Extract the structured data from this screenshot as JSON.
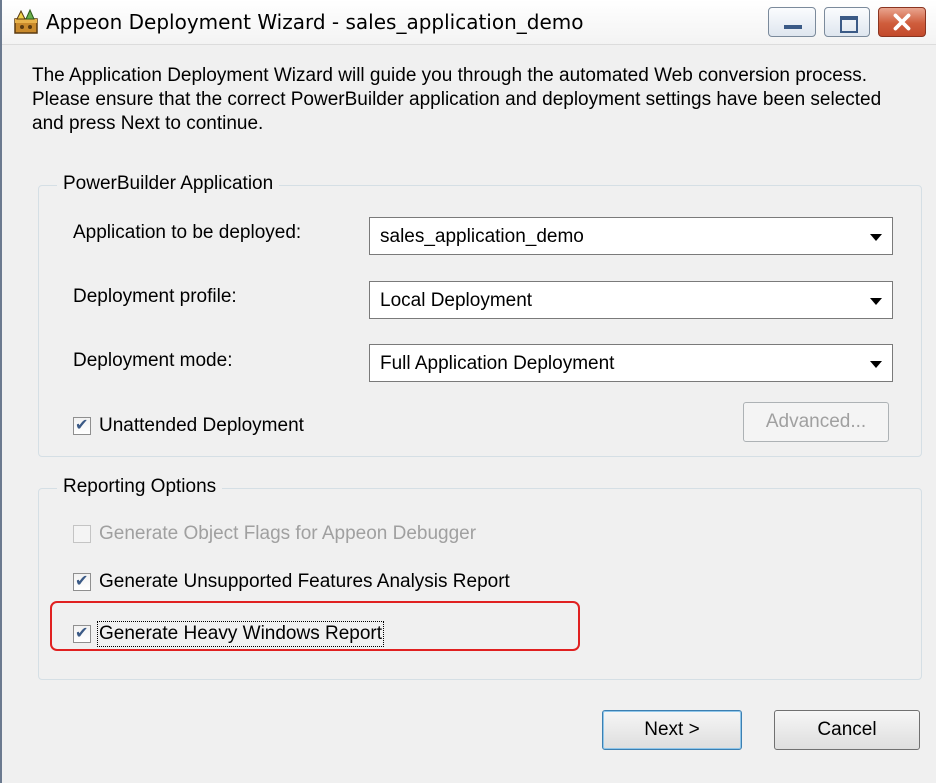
{
  "window": {
    "title": "Appeon Deployment Wizard - sales_application_demo"
  },
  "intro_text": "The Application Deployment Wizard will guide you through the automated Web conversion process.  Please ensure that the correct PowerBuilder application and deployment settings have been selected and press Next to continue.",
  "powerbuilder_group": {
    "label": "PowerBuilder Application",
    "application_label": "Application to be deployed:",
    "application_value": "sales_application_demo",
    "profile_label": "Deployment profile:",
    "profile_value": "Local Deployment",
    "mode_label": "Deployment mode:",
    "mode_value": "Full Application Deployment",
    "unattended_label": "Unattended Deployment",
    "unattended_checked": true,
    "advanced_label": "Advanced..."
  },
  "reporting_group": {
    "label": "Reporting Options",
    "object_flags_label": "Generate Object Flags for Appeon Debugger",
    "object_flags_checked": false,
    "unsupported_label": "Generate Unsupported Features Analysis Report",
    "unsupported_checked": true,
    "heavy_windows_label": "Generate Heavy Windows Report",
    "heavy_windows_checked": true
  },
  "footer": {
    "next_label": "Next >",
    "cancel_label": "Cancel"
  },
  "icons": {
    "app": "appeon-wizard-icon",
    "minimize": "minimize-icon",
    "maximize": "maximize-icon",
    "close": "close-icon"
  },
  "colors": {
    "highlight": "#e02020",
    "close_button": "#c34a2c"
  }
}
